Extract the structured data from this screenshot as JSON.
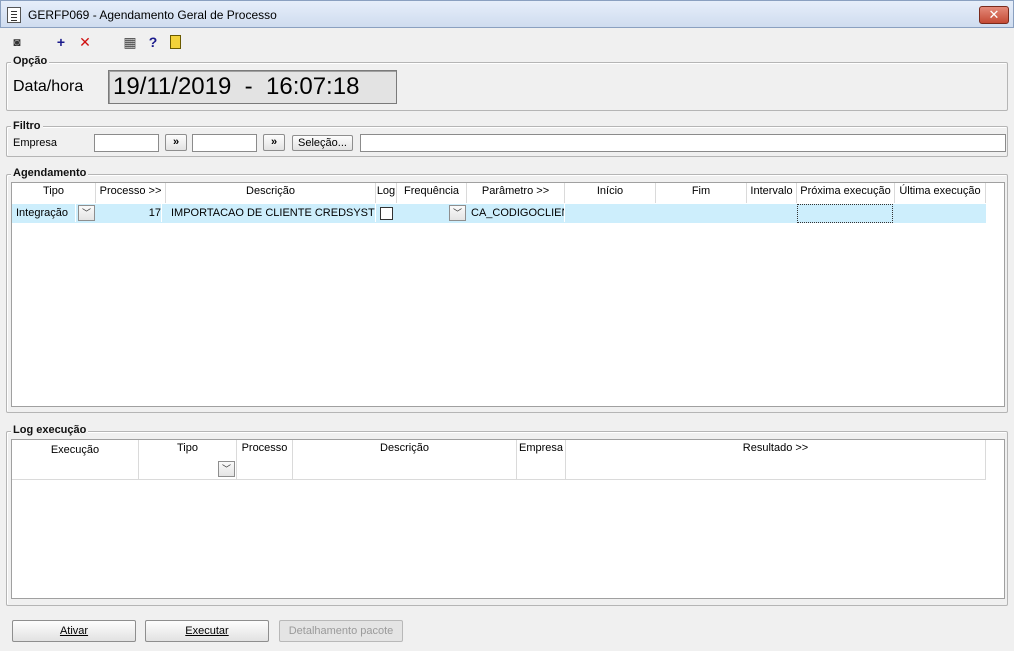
{
  "window": {
    "title": "GERFP069 - Agendamento Geral de Processo",
    "close_label": "✕"
  },
  "toolbar": {
    "exit_glyph": "◙",
    "add_glyph": "+",
    "delete_glyph": "✕",
    "calendar_glyph": "▦",
    "help_glyph": "?",
    "door_glyph": "▯"
  },
  "opcao": {
    "legend": "Opção",
    "label": "Data/hora",
    "value": "19/11/2019  -  16:07:18"
  },
  "filtro": {
    "legend": "Filtro",
    "empresa_label": "Empresa",
    "from_value": "",
    "to_value": "",
    "lookup_label": "»",
    "selecao_label": "Seleção...",
    "selection_text": ""
  },
  "agendamento": {
    "legend": "Agendamento",
    "columns": [
      "Tipo",
      "Processo >>",
      "Descrição",
      "Log",
      "Frequência",
      "Parâmetro >>",
      "Início",
      "Fim",
      "Intervalo",
      "Próxima execução",
      "Última execução"
    ],
    "rows": [
      {
        "tipo": "Integração",
        "processo": "17",
        "descricao": "IMPORTACAO DE CLIENTE CREDSYSTEM",
        "log": false,
        "frequencia": "",
        "parametro": "CA_CODIGOCLIENTE",
        "inicio": "",
        "fim": "",
        "intervalo": "",
        "proxima": "",
        "ultima": ""
      }
    ]
  },
  "log": {
    "legend": "Log execução",
    "columns": [
      "Execução",
      "Tipo",
      "Processo",
      "Descrição",
      "Empresa",
      "Resultado >>"
    ]
  },
  "buttons": {
    "ativar": "Ativar",
    "executar": "Executar",
    "detalhamento": "Detalhamento pacote"
  },
  "colors": {
    "selected_row": "#cdeefc",
    "close_button": "#c44a35",
    "add_icon": "#1a1a8c",
    "delete_icon": "#d01010"
  }
}
